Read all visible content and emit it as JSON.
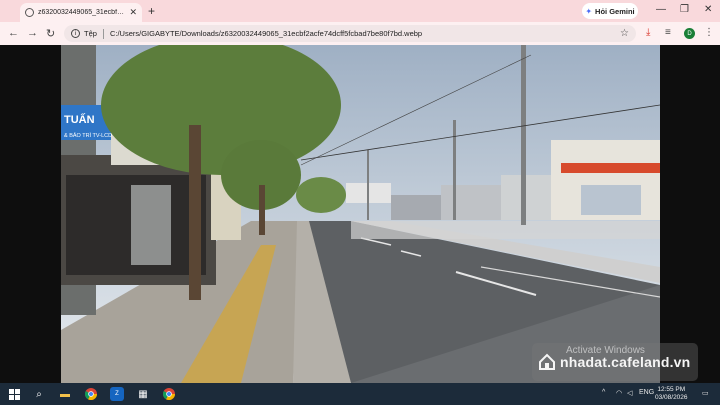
{
  "browser": {
    "tab_title": "z6320032449065_31ecbf2acfe74",
    "new_tab_symbol": "+",
    "gemini_label": "Hỏi Gemini",
    "site_label": "Tệp",
    "url": "C:/Users/GIGABYTE/Downloads/z6320032449065_31ecbf2acfe74dcff5fcbad7be80f7bd.webp",
    "avatar_letter": "D"
  },
  "photo": {
    "sign_text_1": "TUẤN",
    "sign_text_2": "& BẢO TRÌ TV-LCD"
  },
  "overlay": {
    "activate_windows": "Activate Windows",
    "brand": "nhadat.cafeland.vn"
  },
  "taskbar": {
    "lang": "ENG",
    "time": "12:55 PM",
    "date": "03/08/2026"
  }
}
